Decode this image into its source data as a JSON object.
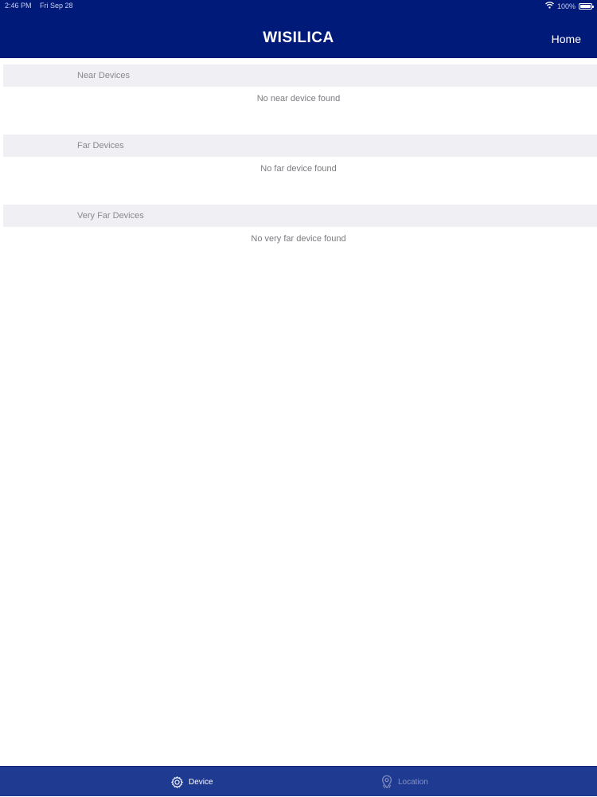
{
  "status_bar": {
    "time": "2:46 PM",
    "date": "Fri Sep 28",
    "battery": "100%",
    "battery_level": 1.0,
    "icons": [
      "wifi-icon",
      "battery-icon"
    ]
  },
  "header": {
    "logo_text": "WISILICA",
    "home_label": "Home",
    "background_color": "#001a7a"
  },
  "sections": [
    {
      "title": "Near Devices",
      "empty_message": "No near device found"
    },
    {
      "title": "Far Devices",
      "empty_message": "No far device found"
    },
    {
      "title": "Very Far Devices",
      "empty_message": "No very far device found"
    }
  ],
  "tab_bar": {
    "background_color": "#1f3a91",
    "tabs": [
      {
        "label": "Device",
        "icon": "gear-icon",
        "selected": true
      },
      {
        "label": "Location",
        "icon": "location-pin-icon",
        "selected": false
      }
    ]
  }
}
